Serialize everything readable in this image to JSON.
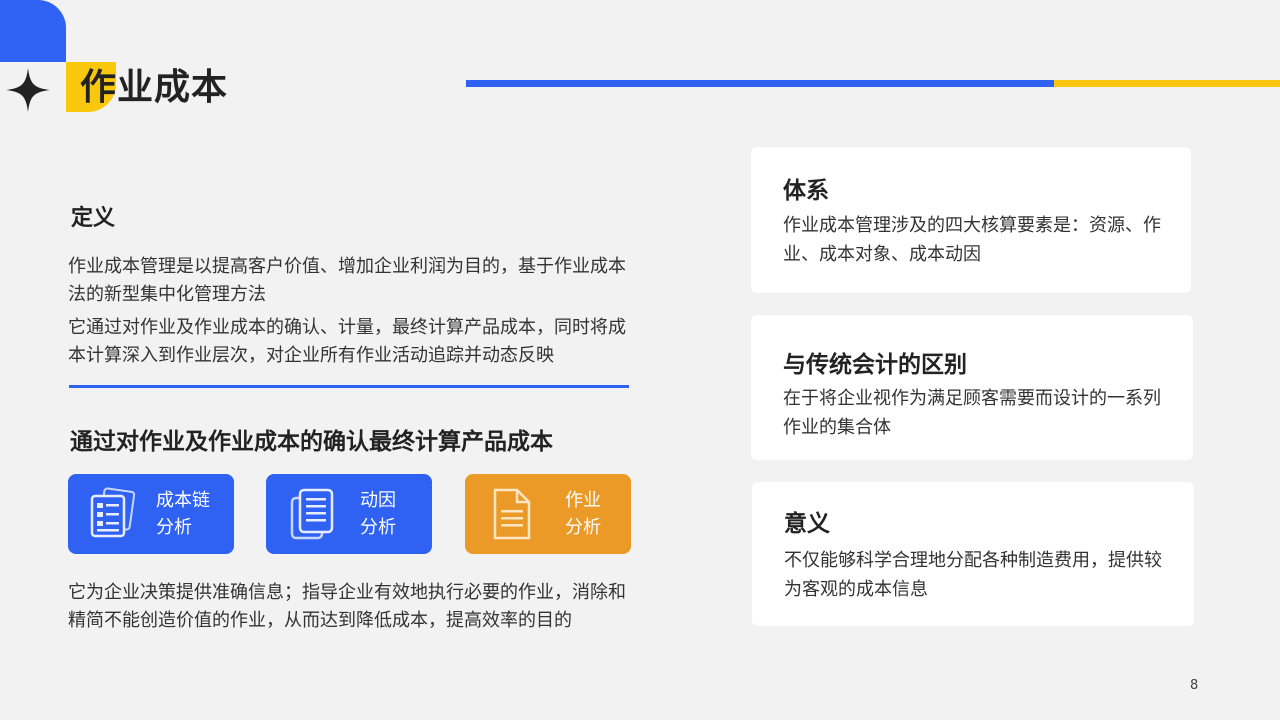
{
  "page": {
    "title": "作业成本",
    "number": "8"
  },
  "definition": {
    "title": "定义",
    "para1": "作业成本管理是以提高客户价值、增加企业利润为目的，基于作业成本法的新型集中化管理方法",
    "para2": "它通过对作业及作业成本的确认、计量，最终计算产品成本，同时将成本计算深入到作业层次，对企业所有作业活动追踪并动态反映"
  },
  "process": {
    "title": "通过对作业及作业成本的确认最终计算产品成本",
    "items": [
      {
        "label_line1": "成本链",
        "label_line2": "分析",
        "icon": "documents-stack-icon",
        "color": "#2f62f3"
      },
      {
        "label_line1": "动因",
        "label_line2": "分析",
        "icon": "copy-documents-icon",
        "color": "#2f62f3"
      },
      {
        "label_line1": "作业",
        "label_line2": "分析",
        "icon": "document-icon",
        "color": "#eb9a28"
      }
    ],
    "summary": "它为企业决策提供准确信息；指导企业有效地执行必要的作业，消除和精简不能创造价值的作业，从而达到降低成本，提高效率的目的"
  },
  "cards": [
    {
      "title": "体系",
      "body": "作业成本管理涉及的四大核算要素是：资源、作业、成本对象、成本动因"
    },
    {
      "title": "与传统会计的区别",
      "body": "在于将企业视作为满足顾客需要而设计的一系列作业的集合体"
    },
    {
      "title": "意义",
      "body": "不仅能够科学合理地分配各种制造费用，提供较为客观的成本信息"
    }
  ],
  "colors": {
    "accent_blue": "#2f62f3",
    "accent_yellow": "#f9c80e",
    "accent_orange": "#eb9a28"
  }
}
